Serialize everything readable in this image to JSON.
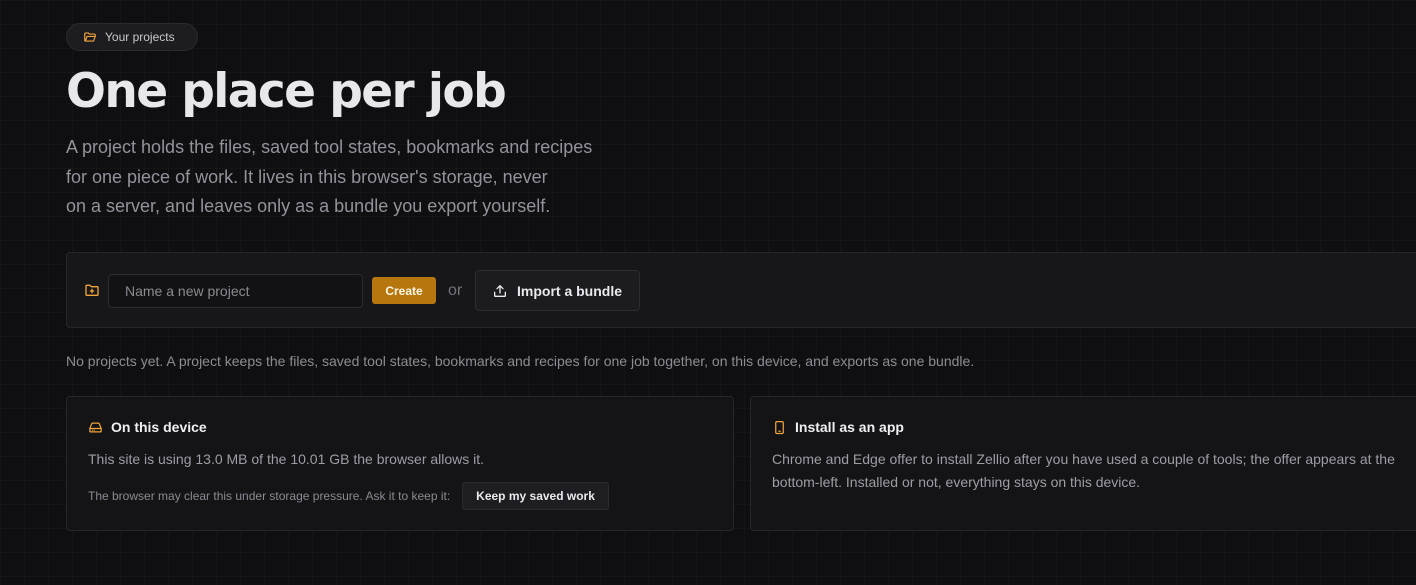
{
  "header": {
    "badge_label": "Your projects",
    "title": "One place per job",
    "lede_lines": [
      "A project holds the files, saved tool states, bookmarks and recipes",
      "for one piece of work. It lives in this browser's storage, never",
      "on a server, and leaves only as a bundle you export yourself."
    ]
  },
  "create_bar": {
    "input_placeholder": "Name a new project",
    "input_value": "",
    "create_label": "Create",
    "or_label": "or",
    "import_label": "Import a bundle"
  },
  "empty_note": "No projects yet. A project keeps the files, saved tool states, bookmarks and recipes for one job together, on this device, and exports as one bundle.",
  "device_card": {
    "title": "On this device",
    "usage_text": "This site is using 13.0 MB of the 10.01 GB the browser allows it.",
    "hint": "The browser may clear this under storage pressure. Ask it to keep it:",
    "keep_label": "Keep my saved work"
  },
  "install_card": {
    "title": "Install as an app",
    "text": "Chrome and Edge offer to install Zellio after you have used a couple of tools; the offer appears at the bottom-left. Installed or not, everything stays on this device."
  },
  "colors": {
    "accent": "#b7770e",
    "icon_accent": "#f0a43a",
    "background": "#0f0f11"
  },
  "icons": {
    "badge": "folder-open-icon",
    "create_bar": "folder-plus-icon",
    "import": "upload-icon",
    "device": "hard-drive-icon",
    "install": "smartphone-icon"
  }
}
